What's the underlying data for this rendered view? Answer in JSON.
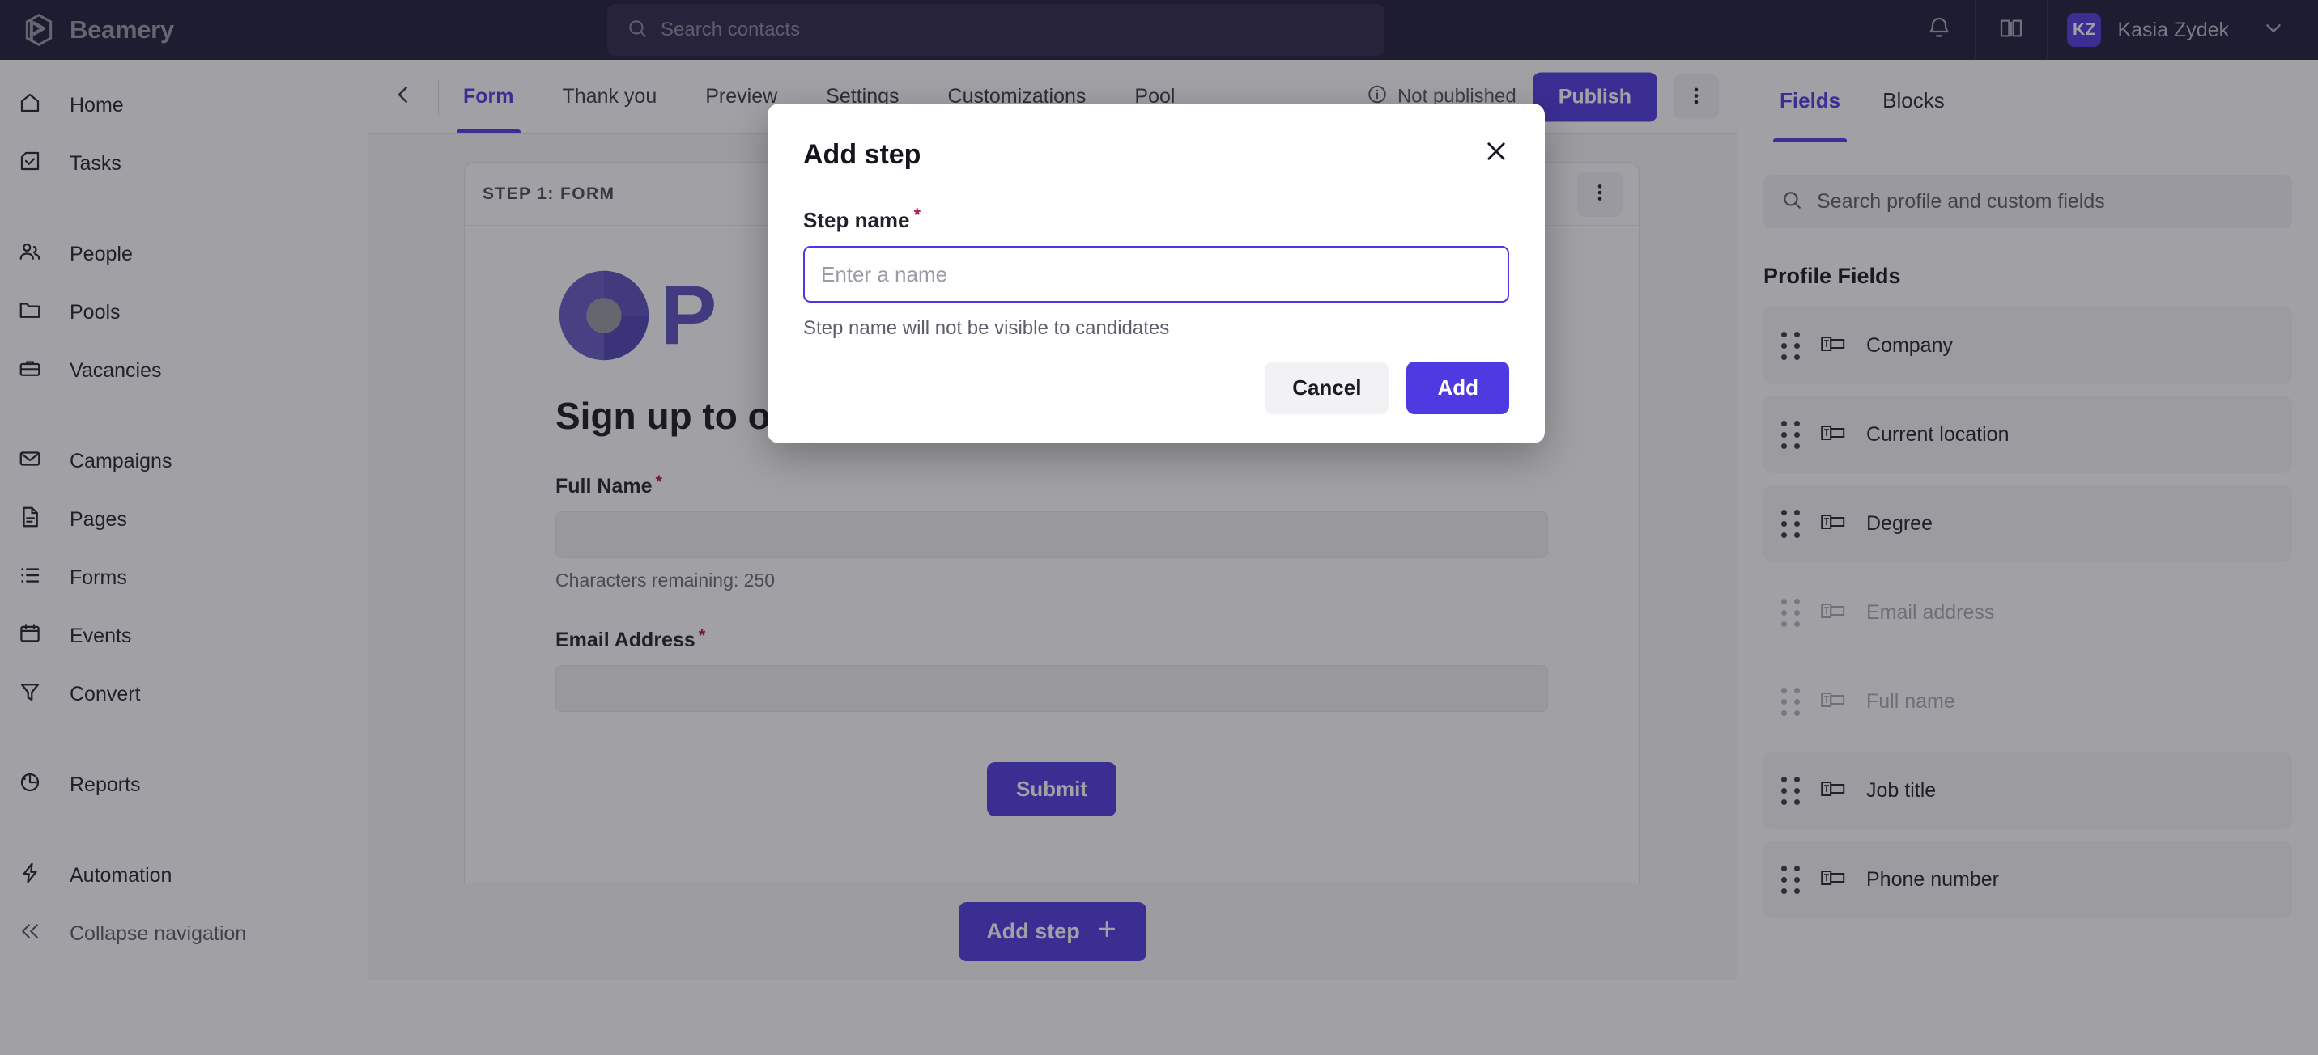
{
  "brand": {
    "name": "Beamery",
    "logo_icon": "beamery-logo-icon"
  },
  "topbar": {
    "search_placeholder": "Search contacts",
    "search_icon": "search-icon",
    "notifications_icon": "bell-icon",
    "knowledge_icon": "book-icon",
    "user": {
      "initials": "KZ",
      "name": "Kasia Zydek"
    },
    "chevron_icon": "chevron-down-icon",
    "avatar_color": "#4f39e0"
  },
  "sidebar": {
    "groups": [
      {
        "items": [
          {
            "label": "Home",
            "icon": "home-icon"
          },
          {
            "label": "Tasks",
            "icon": "tasks-check-icon"
          }
        ]
      },
      {
        "items": [
          {
            "label": "People",
            "icon": "people-icon"
          },
          {
            "label": "Pools",
            "icon": "folder-icon"
          },
          {
            "label": "Vacancies",
            "icon": "briefcase-icon"
          }
        ]
      },
      {
        "items": [
          {
            "label": "Campaigns",
            "icon": "envelope-icon"
          },
          {
            "label": "Pages",
            "icon": "document-icon"
          },
          {
            "label": "Forms",
            "icon": "list-icon"
          },
          {
            "label": "Events",
            "icon": "calendar-icon"
          },
          {
            "label": "Convert",
            "icon": "funnel-icon"
          }
        ]
      },
      {
        "items": [
          {
            "label": "Reports",
            "icon": "pie-chart-icon"
          }
        ]
      },
      {
        "items": [
          {
            "label": "Automation",
            "icon": "lightning-icon"
          },
          {
            "label": "Collapse navigation",
            "icon": "double-chevron-left-icon"
          }
        ]
      }
    ]
  },
  "subheader": {
    "back_icon": "chevron-left-icon",
    "tabs": [
      {
        "label": "Form",
        "active": true
      },
      {
        "label": "Thank you",
        "active": false
      },
      {
        "label": "Preview",
        "active": false
      },
      {
        "label": "Settings",
        "active": false
      },
      {
        "label": "Customizations",
        "active": false
      },
      {
        "label": "Pool",
        "active": false
      }
    ],
    "status_text": "Not published",
    "status_icon": "info-circle-icon",
    "publish_label": "Publish",
    "kebab_icon": "kebab-menu-icon",
    "accent_color": "#4f39e0"
  },
  "canvas": {
    "step_card": {
      "title": "STEP 1: FORM",
      "kebab_icon": "kebab-menu-icon",
      "logo_icon": "company-donut-logo-icon",
      "logo_text": "P",
      "heading": "Sign up to our Talent Community!",
      "fields": [
        {
          "label": "Full Name",
          "required": true,
          "value": "",
          "help": "Characters remaining: 250"
        },
        {
          "label": "Email Address",
          "required": true,
          "value": "",
          "help": ""
        }
      ],
      "submit_label": "Submit"
    },
    "add_step_label": "Add step",
    "add_step_icon": "plus-icon"
  },
  "right_panel": {
    "tabs": [
      {
        "label": "Fields",
        "active": true
      },
      {
        "label": "Blocks",
        "active": false
      }
    ],
    "search_placeholder": "Search profile and custom fields",
    "search_icon": "search-icon",
    "section_title": "Profile Fields",
    "fields": [
      {
        "label": "Company",
        "used": false
      },
      {
        "label": "Current location",
        "used": false
      },
      {
        "label": "Degree",
        "used": false
      },
      {
        "label": "Email address",
        "used": true
      },
      {
        "label": "Full name",
        "used": true
      },
      {
        "label": "Job title",
        "used": false
      },
      {
        "label": "Phone number",
        "used": false
      }
    ],
    "grip_icon": "drag-handle-icon",
    "field_icon": "text-field-icon"
  },
  "modal": {
    "title": "Add step",
    "close_icon": "close-icon",
    "field_label": "Step name",
    "required_marker": "*",
    "input_value": "",
    "input_placeholder": "Enter a name",
    "help_text": "Step name will not be visible to candidates",
    "cancel_label": "Cancel",
    "add_label": "Add"
  }
}
